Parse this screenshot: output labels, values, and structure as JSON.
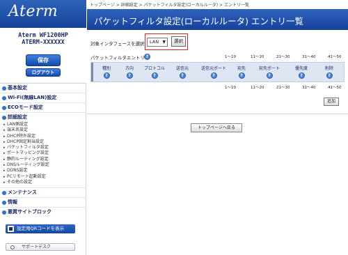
{
  "sidebar": {
    "logo": "Aterm",
    "model_name": "Aterm WF1200HP",
    "model_id": "ATERM-XXXXXX",
    "save_label": "保存",
    "logout_label": "ログアウト",
    "sections": [
      {
        "label": "基本設定"
      },
      {
        "label": "Wi-Fi(無線LAN)設定"
      },
      {
        "label": "ECOモード設定"
      },
      {
        "label": "詳細設定",
        "items": [
          "LAN側設定",
          "端末名設定",
          "DHCP除外設定",
          "DHCP固定割当設定",
          "パケットフィルタ設定",
          "ポートマッピング設定",
          "静的ルーティング設定",
          "DNSルーティング設定",
          "DDNS設定",
          "PCリモート起動設定",
          "その他の設定"
        ]
      },
      {
        "label": "メンテナンス"
      },
      {
        "label": "情報"
      },
      {
        "label": "悪質サイトブロック"
      }
    ],
    "qr_label": "設定用QRコードを表示",
    "support_label": "サポートデスク"
  },
  "main": {
    "breadcrumb": "トップページ > 詳細設定 > パケットフィルタ設定(ローカルルータ) > エントリ一覧",
    "title": "パケットフィルタ設定(ローカルルータ) エントリ一覧",
    "interface_label": "対象インタフェースを選択",
    "interface_value": "LAN",
    "select_label": "選択",
    "entry_label": "パケットフィルタエントリ",
    "help_glyph": "?",
    "pager": [
      "1〜10",
      "11〜20",
      "21〜30",
      "31〜40",
      "41〜50"
    ],
    "columns": [
      "種別",
      "方向",
      "プロトコル",
      "送信元",
      "送信元ポート",
      "宛先",
      "宛先ポート",
      "優先度",
      "削除"
    ],
    "add_label": "追加",
    "top_label": "トップページへ戻る"
  },
  "colors": {
    "title_bar": "#1f4ea8",
    "highlight": "#e02020",
    "table_bg": "#dfe6f3"
  }
}
